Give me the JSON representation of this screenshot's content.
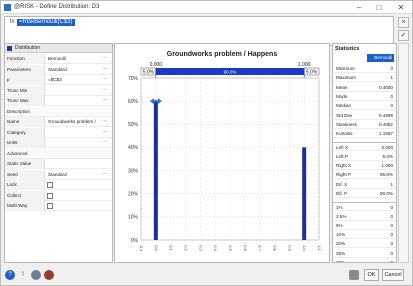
{
  "window": {
    "title": "@RISK - Define Distribution: D3",
    "minimize": "–",
    "maximize": "□",
    "close": "✕"
  },
  "formula": {
    "value": "=RiskBernoulli(C$3)",
    "fx_icon": "fx"
  },
  "left_panel": {
    "header": "Distribution",
    "rows": [
      {
        "key": "Function",
        "value": "Bernoulli",
        "dots": true
      },
      {
        "key": "Parameters",
        "value": "Standard",
        "dots": true
      },
      {
        "key": "p",
        "value": "=$C$3",
        "dots": true
      },
      {
        "key": "Trunc Min",
        "value": "",
        "dots": true
      },
      {
        "key": "Trunc Max",
        "value": "",
        "dots": true
      },
      {
        "key": "Description",
        "value": "",
        "dots": false,
        "section": true
      },
      {
        "key": "Name",
        "value": "Groundworks problem /",
        "dots": true
      },
      {
        "key": "Category",
        "value": "",
        "dots": true
      },
      {
        "key": "Units",
        "value": "",
        "dots": true
      },
      {
        "key": "Advanced",
        "value": "",
        "dots": false,
        "section": true
      },
      {
        "key": "Static Value",
        "value": "",
        "dots": false
      },
      {
        "key": "Seed",
        "value": "Standard",
        "dots": true
      },
      {
        "key": "Lock",
        "value": "",
        "checkbox": true
      },
      {
        "key": "Collect",
        "value": "",
        "checkbox": true
      },
      {
        "key": "Multi-Way",
        "value": "",
        "checkbox": true
      }
    ]
  },
  "chart_data": {
    "type": "bar",
    "title": "Groundworks problem / Happens",
    "categories": [
      "0",
      "1"
    ],
    "values": [
      60,
      40
    ],
    "value_unit": "%",
    "ylim": [
      0,
      70
    ],
    "y_ticks": [
      "70%",
      "60%",
      "50%",
      "40%",
      "30%",
      "20%",
      "10%",
      "0%"
    ],
    "x_ticks": [
      "-0.1",
      "0.0",
      "0.1",
      "0.2",
      "0.3",
      "0.4",
      "0.5",
      "0.6",
      "0.7",
      "0.8",
      "0.9",
      "1.0",
      "1.1"
    ],
    "delimiters": {
      "left_value": "0.000",
      "right_value": "1.000",
      "left_pct": "5.0%",
      "middle_pct": "90.0%",
      "right_pct": "5.0%"
    },
    "bar_color": "#1a2f9c",
    "band_color": "#1b3bc7"
  },
  "stats": {
    "title": "Statistics",
    "distribution": "Bernoulli",
    "rows": [
      {
        "k": "Minimum",
        "v": "0"
      },
      {
        "k": "Maximum",
        "v": "1"
      },
      {
        "k": "Mean",
        "v": "0.4000"
      },
      {
        "k": "Mode",
        "v": "0"
      },
      {
        "k": "Median",
        "v": "0"
      },
      {
        "k": "Std Dev",
        "v": "0.4899"
      },
      {
        "k": "Skewness",
        "v": "0.4082"
      },
      {
        "k": "Kurtosis",
        "v": "1.1667"
      },
      {
        "k": "Left X",
        "v": "0.000",
        "gap": true
      },
      {
        "k": "Left P",
        "v": "5.0%"
      },
      {
        "k": "Right X",
        "v": "1.000"
      },
      {
        "k": "Right P",
        "v": "95.0%"
      },
      {
        "k": "Dif. X",
        "v": "1"
      },
      {
        "k": "Dif. P",
        "v": "90.0%"
      },
      {
        "k": "1%",
        "v": "0",
        "gap": true
      },
      {
        "k": "2.5%",
        "v": "0"
      },
      {
        "k": "5%",
        "v": "0"
      },
      {
        "k": "10%",
        "v": "0"
      },
      {
        "k": "20%",
        "v": "0"
      },
      {
        "k": "25%",
        "v": "0"
      },
      {
        "k": "30%",
        "v": "0"
      }
    ]
  },
  "bottom": {
    "help_icon": "?",
    "warning_icon": "!",
    "ok": "OK",
    "cancel": "Cancel"
  },
  "colors": {
    "accent": "#1b5fc7",
    "bar": "#1a2f9c",
    "handle": "#2a6fd1"
  }
}
